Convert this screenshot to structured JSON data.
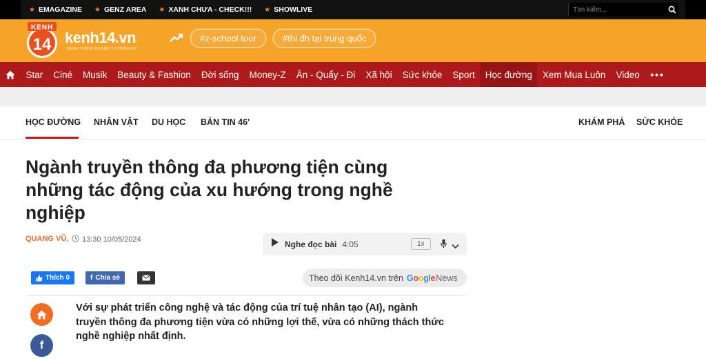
{
  "topbar": {
    "links": [
      "EMAGAZINE",
      "GENZ AREA",
      "XANH CHƯA - CHECK!!!",
      "SHOWLIVE"
    ],
    "search_placeholder": "Tìm kiếm..."
  },
  "brand": {
    "logo_badge_top": "KENH",
    "logo_badge_num": "14",
    "site_name": "kenh14.vn",
    "tagline": "TRANG THÔNG TIN ĐIỆN TỬ TỔNG HỢP",
    "tags": [
      "#z-school tour",
      "#thi đh tại trung quốc"
    ]
  },
  "nav": {
    "items": [
      "Star",
      "Ciné",
      "Musik",
      "Beauty & Fashion",
      "Đời sống",
      "Money-Z",
      "Ăn - Quẩy - Đi",
      "Xã hội",
      "Sức khỏe",
      "Sport",
      "Học đường",
      "Xem Mua Luôn",
      "Video"
    ],
    "active": "Học đường",
    "more": "•••"
  },
  "subnav": {
    "left": [
      "HỌC ĐƯỜNG",
      "NHÂN VẬT",
      "DU HỌC",
      "BẢN TIN 46'"
    ],
    "right": [
      "KHÁM PHÁ",
      "SỨC KHỎE"
    ]
  },
  "article": {
    "title": "Ngành truyền thông đa phương tiện cùng những tác động của xu hướng trong nghề nghiệp",
    "author": "QUANG VŨ,",
    "time": "13:30 10/05/2024",
    "audio": {
      "label": "Nghe đọc bài",
      "duration": "4:05",
      "speed": "1x"
    },
    "share": {
      "like": "Thích 0",
      "share": "Chia sẻ"
    },
    "google_news": {
      "prefix": "Theo dõi Kenh14.vn trên",
      "brand": "Google",
      "suffix": "News"
    },
    "sapo": "Với sự phát triển công nghệ và tác động của trí tuệ nhân tạo (AI), ngành truyền thông đa phương tiện vừa có những lợi thế, vừa có những thách thức nghề nghiệp nhất định."
  },
  "colors": {
    "brand_orange": "#f6a32a",
    "nav_red": "#ad1a1b",
    "accent_red": "#c3191b",
    "author_orange": "#e96c2a"
  }
}
